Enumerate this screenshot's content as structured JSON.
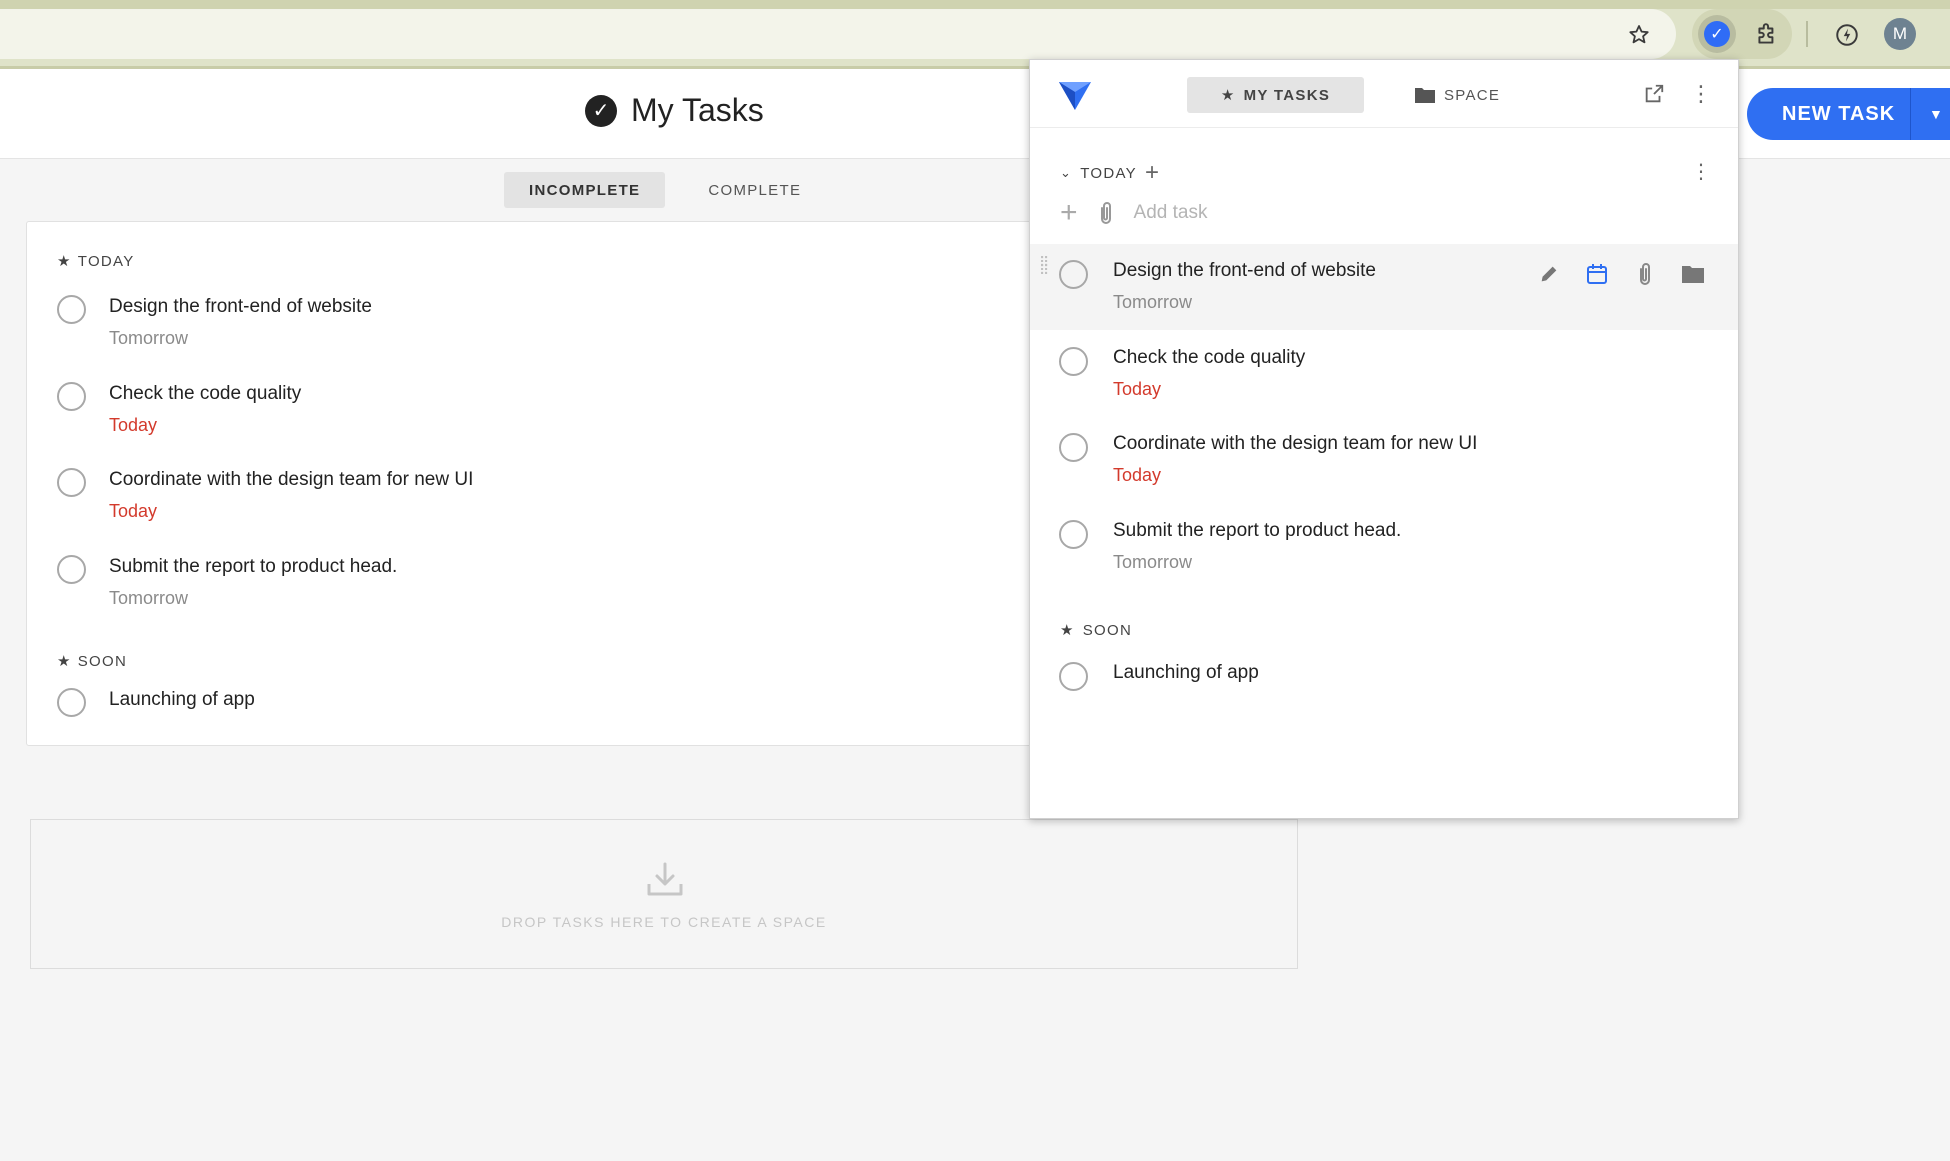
{
  "browser": {
    "avatar_initial": "M"
  },
  "app": {
    "title": "My Tasks",
    "new_task_label": "NEW TASK",
    "filter_tabs": [
      "INCOMPLETE",
      "COMPLETE"
    ]
  },
  "main": {
    "sections": [
      {
        "label": "TODAY",
        "tasks": [
          {
            "title": "Design the front-end of website",
            "due": "Tomorrow"
          },
          {
            "title": "Check the code quality",
            "due": "Today"
          },
          {
            "title": "Coordinate with the design team for new UI",
            "due": "Today"
          },
          {
            "title": "Submit the report to product head.",
            "due": "Tomorrow"
          }
        ]
      },
      {
        "label": "SOON",
        "tasks": [
          {
            "title": "Launching of app"
          }
        ]
      }
    ],
    "drop_zone_text": "DROP TASKS HERE TO CREATE A SPACE"
  },
  "popup": {
    "tabs": [
      "MY TASKS",
      "SPACE"
    ],
    "today_label": "TODAY",
    "add_task_placeholder": "Add task",
    "soon_label": "SOON",
    "tasks": [
      {
        "title": "Design the front-end of website",
        "due": "Tomorrow"
      },
      {
        "title": "Check the code quality",
        "due": "Today"
      },
      {
        "title": "Coordinate with the design team for new UI",
        "due": "Today"
      },
      {
        "title": "Submit the report to product head.",
        "due": "Tomorrow"
      }
    ],
    "soon_tasks": [
      {
        "title": "Launching of app"
      }
    ]
  },
  "colors": {
    "accent": "#2f6ff2",
    "due_today": "#d33a2c",
    "due_later": "#8a8a8a"
  }
}
